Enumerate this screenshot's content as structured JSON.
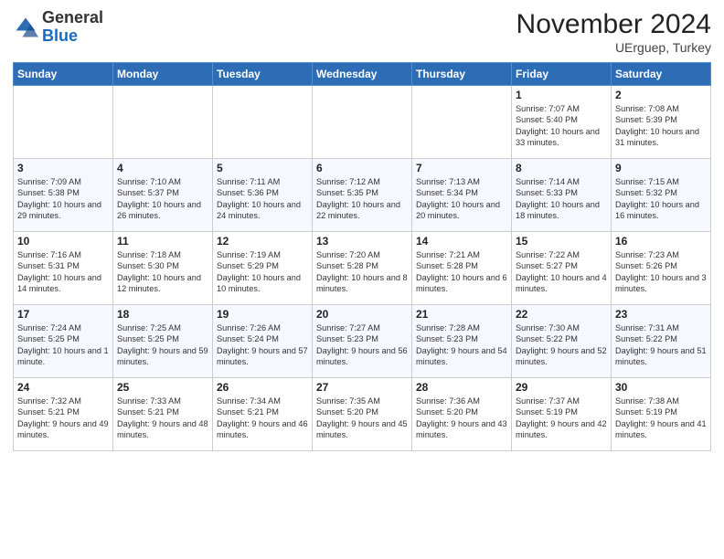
{
  "header": {
    "logo_line1": "General",
    "logo_line2": "Blue",
    "month": "November 2024",
    "location": "UErguep, Turkey"
  },
  "weekdays": [
    "Sunday",
    "Monday",
    "Tuesday",
    "Wednesday",
    "Thursday",
    "Friday",
    "Saturday"
  ],
  "weeks": [
    [
      {
        "day": "",
        "info": ""
      },
      {
        "day": "",
        "info": ""
      },
      {
        "day": "",
        "info": ""
      },
      {
        "day": "",
        "info": ""
      },
      {
        "day": "",
        "info": ""
      },
      {
        "day": "1",
        "info": "Sunrise: 7:07 AM\nSunset: 5:40 PM\nDaylight: 10 hours\nand 33 minutes."
      },
      {
        "day": "2",
        "info": "Sunrise: 7:08 AM\nSunset: 5:39 PM\nDaylight: 10 hours\nand 31 minutes."
      }
    ],
    [
      {
        "day": "3",
        "info": "Sunrise: 7:09 AM\nSunset: 5:38 PM\nDaylight: 10 hours\nand 29 minutes."
      },
      {
        "day": "4",
        "info": "Sunrise: 7:10 AM\nSunset: 5:37 PM\nDaylight: 10 hours\nand 26 minutes."
      },
      {
        "day": "5",
        "info": "Sunrise: 7:11 AM\nSunset: 5:36 PM\nDaylight: 10 hours\nand 24 minutes."
      },
      {
        "day": "6",
        "info": "Sunrise: 7:12 AM\nSunset: 5:35 PM\nDaylight: 10 hours\nand 22 minutes."
      },
      {
        "day": "7",
        "info": "Sunrise: 7:13 AM\nSunset: 5:34 PM\nDaylight: 10 hours\nand 20 minutes."
      },
      {
        "day": "8",
        "info": "Sunrise: 7:14 AM\nSunset: 5:33 PM\nDaylight: 10 hours\nand 18 minutes."
      },
      {
        "day": "9",
        "info": "Sunrise: 7:15 AM\nSunset: 5:32 PM\nDaylight: 10 hours\nand 16 minutes."
      }
    ],
    [
      {
        "day": "10",
        "info": "Sunrise: 7:16 AM\nSunset: 5:31 PM\nDaylight: 10 hours\nand 14 minutes."
      },
      {
        "day": "11",
        "info": "Sunrise: 7:18 AM\nSunset: 5:30 PM\nDaylight: 10 hours\nand 12 minutes."
      },
      {
        "day": "12",
        "info": "Sunrise: 7:19 AM\nSunset: 5:29 PM\nDaylight: 10 hours\nand 10 minutes."
      },
      {
        "day": "13",
        "info": "Sunrise: 7:20 AM\nSunset: 5:28 PM\nDaylight: 10 hours\nand 8 minutes."
      },
      {
        "day": "14",
        "info": "Sunrise: 7:21 AM\nSunset: 5:28 PM\nDaylight: 10 hours\nand 6 minutes."
      },
      {
        "day": "15",
        "info": "Sunrise: 7:22 AM\nSunset: 5:27 PM\nDaylight: 10 hours\nand 4 minutes."
      },
      {
        "day": "16",
        "info": "Sunrise: 7:23 AM\nSunset: 5:26 PM\nDaylight: 10 hours\nand 3 minutes."
      }
    ],
    [
      {
        "day": "17",
        "info": "Sunrise: 7:24 AM\nSunset: 5:25 PM\nDaylight: 10 hours\nand 1 minute."
      },
      {
        "day": "18",
        "info": "Sunrise: 7:25 AM\nSunset: 5:25 PM\nDaylight: 9 hours\nand 59 minutes."
      },
      {
        "day": "19",
        "info": "Sunrise: 7:26 AM\nSunset: 5:24 PM\nDaylight: 9 hours\nand 57 minutes."
      },
      {
        "day": "20",
        "info": "Sunrise: 7:27 AM\nSunset: 5:23 PM\nDaylight: 9 hours\nand 56 minutes."
      },
      {
        "day": "21",
        "info": "Sunrise: 7:28 AM\nSunset: 5:23 PM\nDaylight: 9 hours\nand 54 minutes."
      },
      {
        "day": "22",
        "info": "Sunrise: 7:30 AM\nSunset: 5:22 PM\nDaylight: 9 hours\nand 52 minutes."
      },
      {
        "day": "23",
        "info": "Sunrise: 7:31 AM\nSunset: 5:22 PM\nDaylight: 9 hours\nand 51 minutes."
      }
    ],
    [
      {
        "day": "24",
        "info": "Sunrise: 7:32 AM\nSunset: 5:21 PM\nDaylight: 9 hours\nand 49 minutes."
      },
      {
        "day": "25",
        "info": "Sunrise: 7:33 AM\nSunset: 5:21 PM\nDaylight: 9 hours\nand 48 minutes."
      },
      {
        "day": "26",
        "info": "Sunrise: 7:34 AM\nSunset: 5:21 PM\nDaylight: 9 hours\nand 46 minutes."
      },
      {
        "day": "27",
        "info": "Sunrise: 7:35 AM\nSunset: 5:20 PM\nDaylight: 9 hours\nand 45 minutes."
      },
      {
        "day": "28",
        "info": "Sunrise: 7:36 AM\nSunset: 5:20 PM\nDaylight: 9 hours\nand 43 minutes."
      },
      {
        "day": "29",
        "info": "Sunrise: 7:37 AM\nSunset: 5:19 PM\nDaylight: 9 hours\nand 42 minutes."
      },
      {
        "day": "30",
        "info": "Sunrise: 7:38 AM\nSunset: 5:19 PM\nDaylight: 9 hours\nand 41 minutes."
      }
    ]
  ]
}
